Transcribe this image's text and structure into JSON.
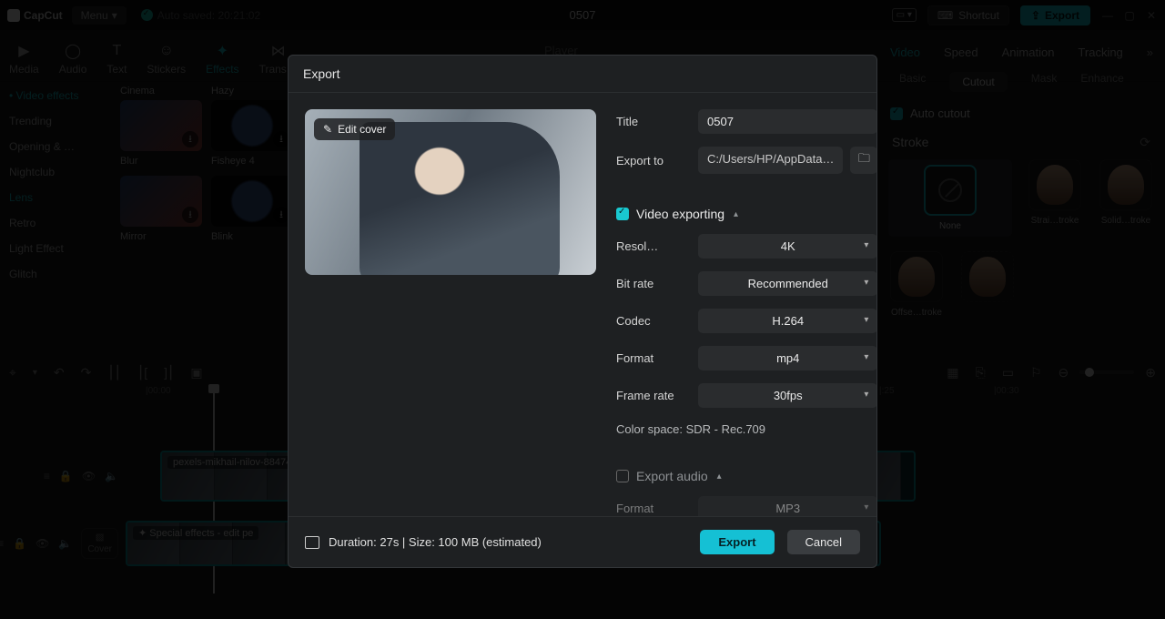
{
  "app": {
    "name": "CapCut",
    "menu": "Menu",
    "autosave": "Auto saved: 20:21:02",
    "title": "0507"
  },
  "topright": {
    "shortcut": "Shortcut",
    "export": "Export"
  },
  "tooltabs": [
    "Media",
    "Audio",
    "Text",
    "Stickers",
    "Effects",
    "Trans…"
  ],
  "tooltabs_active": 4,
  "left": {
    "header": "Video effects",
    "items": [
      "Trending",
      "Opening & …",
      "Nightclub",
      "Lens",
      "Retro",
      "Light Effect",
      "Glitch"
    ],
    "selected": "Lens"
  },
  "thumbs_top": [
    "Cinema",
    "Hazy"
  ],
  "thumbs": [
    {
      "label": "Blur"
    },
    {
      "label": "Fisheye 4"
    },
    {
      "label": "Mirror"
    },
    {
      "label": "Blink"
    }
  ],
  "player_label": "Player",
  "right": {
    "tabs": [
      "Video",
      "Speed",
      "Animation",
      "Tracking"
    ],
    "subtabs": [
      "Basic",
      "Cutout",
      "Mask",
      "Enhance"
    ],
    "subtab_active": "Cutout",
    "autocutout": "Auto cutout",
    "stroke": "Stroke",
    "stroke_opts": [
      "None",
      "Strai…troke",
      "Solid…troke",
      "Offse…troke"
    ]
  },
  "timeruler": {
    "t0": "|00:00",
    "t25": "|:25",
    "t30": "|00:30"
  },
  "tracks": {
    "clip1": "pexels-mikhail-nilov-88474",
    "clip2": "Special effects - edit  pe",
    "cover": "Cover"
  },
  "modal": {
    "title": "Export",
    "editcover": "Edit cover",
    "title_label": "Title",
    "title_value": "0507",
    "exportto_label": "Export to",
    "exportto_value": "C:/Users/HP/AppData…",
    "videoexporting": "Video exporting",
    "rows": {
      "resolution": {
        "label": "Resol…",
        "value": "4K"
      },
      "bitrate": {
        "label": "Bit rate",
        "value": "Recommended"
      },
      "codec": {
        "label": "Codec",
        "value": "H.264"
      },
      "format": {
        "label": "Format",
        "value": "mp4"
      },
      "framerate": {
        "label": "Frame rate",
        "value": "30fps"
      }
    },
    "colorspace": "Color space: SDR - Rec.709",
    "exportaudio": "Export audio",
    "audioformat_label": "Format",
    "audioformat_value": "MP3",
    "duration": "Duration: 27s | Size: 100 MB (estimated)",
    "export_btn": "Export",
    "cancel_btn": "Cancel"
  }
}
